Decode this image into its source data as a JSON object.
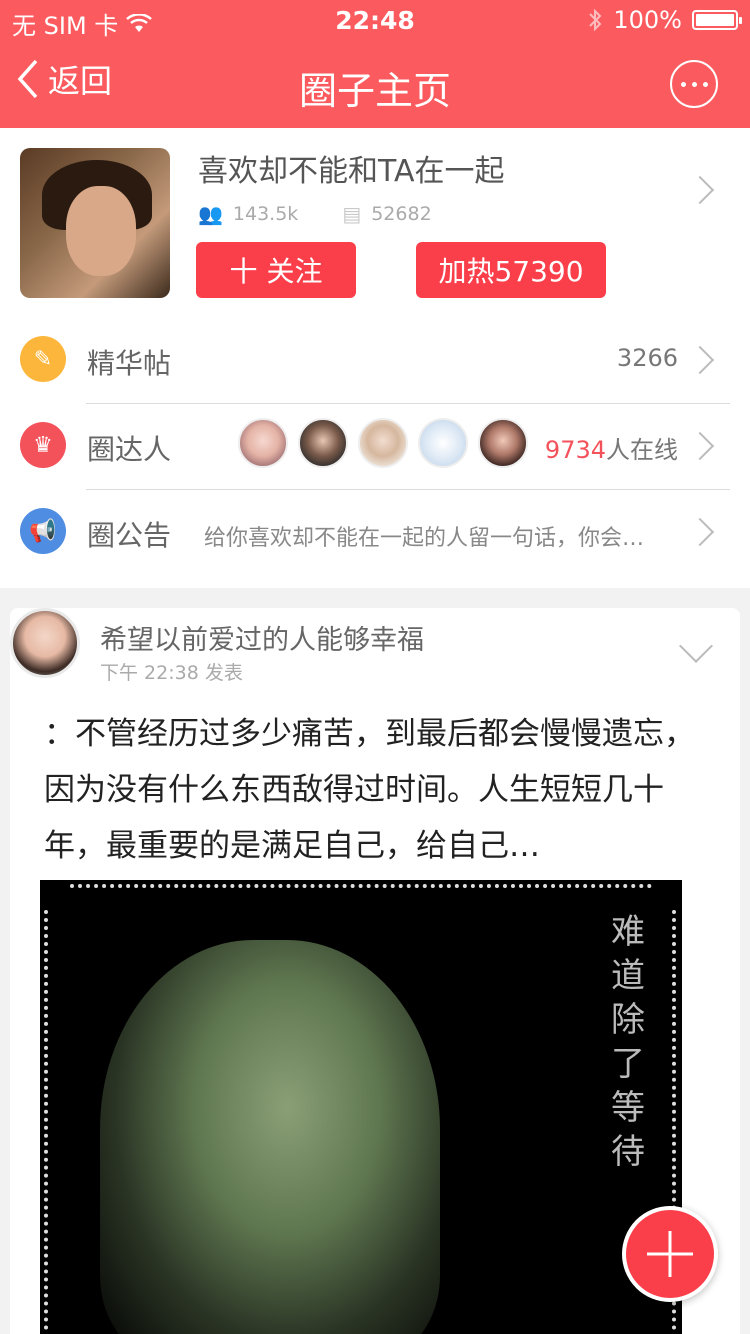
{
  "status_bar": {
    "carrier": "无 SIM 卡",
    "time": "22:48",
    "battery": "100%"
  },
  "nav": {
    "back_label": "返回",
    "title": "圈子主页"
  },
  "circle": {
    "name": "喜欢却不能和TA在一起",
    "members": "143.5k",
    "posts": "52682",
    "follow_label": "十 关注",
    "heat_label": "加热57390"
  },
  "rows": {
    "featured": {
      "label": "精华帖",
      "count": "3266"
    },
    "experts": {
      "label": "圈达人",
      "online_num": "9734",
      "online_suffix": "人在线"
    },
    "notice": {
      "label": "圈公告",
      "text": "给你喜欢却不能在一起的人留一句话，你会…"
    }
  },
  "post": {
    "author": "希望以前爱过的人能够幸福",
    "time": "下午 22:38 发表",
    "content": "：不管经历过多少痛苦，到最后都会慢慢遗忘，因为没有什么东西敌得过时间。人生短短几十年，最重要的是满足自己，给自己…",
    "image_text": "难道除了等待"
  },
  "colors": {
    "brand": "#fb5b5f",
    "button": "#fa3f4b",
    "online_highlight": "#f4525b"
  }
}
